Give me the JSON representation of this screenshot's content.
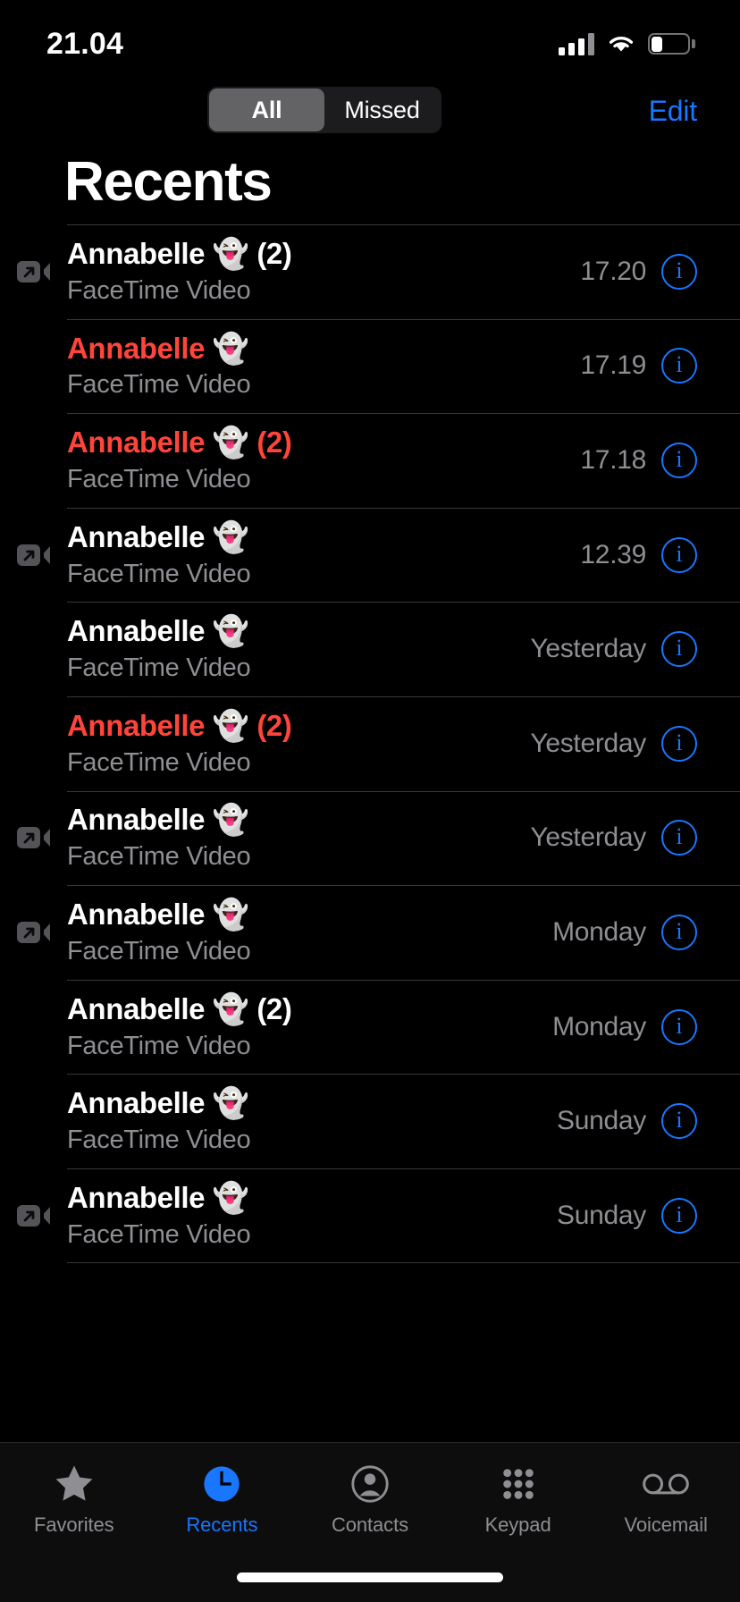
{
  "status_bar": {
    "time": "21.04",
    "signal_icon": "cellular-signal-icon",
    "wifi_icon": "wifi-icon",
    "battery_icon": "battery-icon",
    "battery_level_pct": 30
  },
  "nav": {
    "segments": [
      {
        "label": "All",
        "selected": true
      },
      {
        "label": "Missed",
        "selected": false
      }
    ],
    "edit_label": "Edit"
  },
  "page_title": "Recents",
  "colors": {
    "accent_blue": "#1976ff",
    "missed_red": "#ff453a",
    "secondary_gray": "#8e8e93",
    "separator": "#38383a",
    "segment_track": "#1c1c1e",
    "segment_selected": "#636366",
    "background": "#000000"
  },
  "calls": [
    {
      "name": "Annabelle 👻",
      "count": "(2)",
      "missed": false,
      "outgoing": true,
      "subtitle": "FaceTime Video",
      "time": "17.20"
    },
    {
      "name": "Annabelle 👻",
      "count": "",
      "missed": true,
      "outgoing": false,
      "subtitle": "FaceTime Video",
      "time": "17.19"
    },
    {
      "name": "Annabelle 👻",
      "count": "(2)",
      "missed": true,
      "outgoing": false,
      "subtitle": "FaceTime Video",
      "time": "17.18"
    },
    {
      "name": "Annabelle 👻",
      "count": "",
      "missed": false,
      "outgoing": true,
      "subtitle": "FaceTime Video",
      "time": "12.39"
    },
    {
      "name": "Annabelle 👻",
      "count": "",
      "missed": false,
      "outgoing": false,
      "subtitle": "FaceTime Video",
      "time": "Yesterday"
    },
    {
      "name": "Annabelle 👻",
      "count": "(2)",
      "missed": true,
      "outgoing": false,
      "subtitle": "FaceTime Video",
      "time": "Yesterday"
    },
    {
      "name": "Annabelle 👻",
      "count": "",
      "missed": false,
      "outgoing": true,
      "subtitle": "FaceTime Video",
      "time": "Yesterday"
    },
    {
      "name": "Annabelle 👻",
      "count": "",
      "missed": false,
      "outgoing": true,
      "subtitle": "FaceTime Video",
      "time": "Monday"
    },
    {
      "name": "Annabelle 👻",
      "count": "(2)",
      "missed": false,
      "outgoing": false,
      "subtitle": "FaceTime Video",
      "time": "Monday"
    },
    {
      "name": "Annabelle 👻",
      "count": "",
      "missed": false,
      "outgoing": false,
      "subtitle": "FaceTime Video",
      "time": "Sunday"
    },
    {
      "name": "Annabelle 👻",
      "count": "",
      "missed": false,
      "outgoing": true,
      "subtitle": "FaceTime Video",
      "time": "Sunday"
    }
  ],
  "info_button_glyph": "i",
  "tab_bar": {
    "tabs": [
      {
        "label": "Favorites",
        "icon": "star-icon",
        "active": false
      },
      {
        "label": "Recents",
        "icon": "clock-icon",
        "active": true
      },
      {
        "label": "Contacts",
        "icon": "person-circle-icon",
        "active": false
      },
      {
        "label": "Keypad",
        "icon": "keypad-grid-icon",
        "active": false
      },
      {
        "label": "Voicemail",
        "icon": "voicemail-icon",
        "active": false
      }
    ]
  }
}
